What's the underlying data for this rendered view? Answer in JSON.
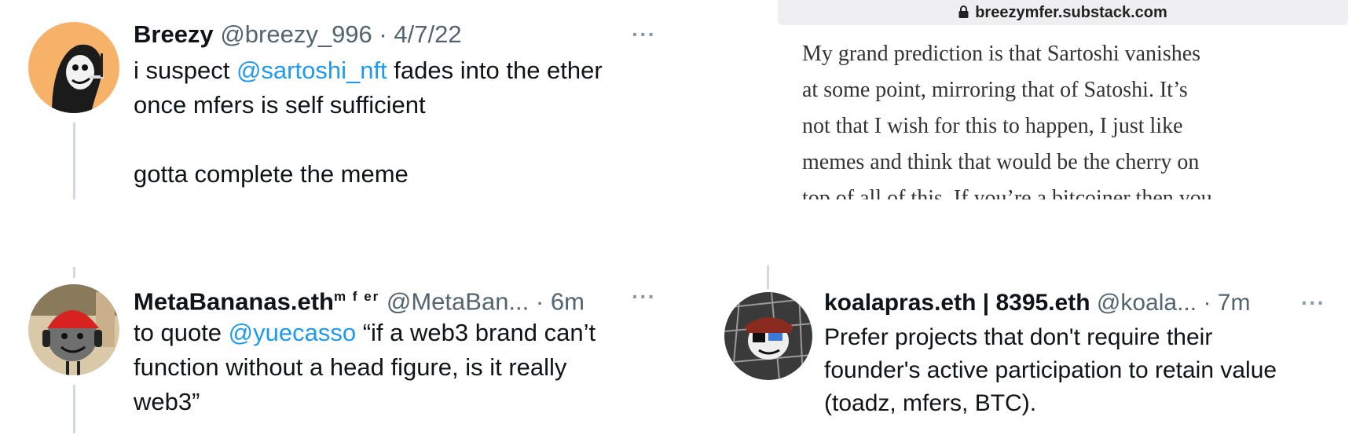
{
  "tweet1": {
    "display_name": "Breezy",
    "handle": "@breezy_996",
    "separator": "·",
    "timestamp": "4/7/22",
    "more": "···",
    "text_before": "i suspect ",
    "mention": "@sartoshi_nft",
    "text_after": " fades into the ether",
    "line2": "once mfers is self sufficient",
    "line3": "gotta complete the meme"
  },
  "substack": {
    "url": "breezymfer.substack.com",
    "lock_icon": "lock-icon",
    "lines": [
      "My grand prediction is that Sartoshi vanishes",
      "at some point, mirroring that of Satoshi. It’s",
      "not that I wish for this to happen, I just like",
      "memes and think that would be the cherry on",
      "top of all of this. If you’re a bitcoiner then you"
    ]
  },
  "tweet2": {
    "display_name": "MetaBananas.eth",
    "name_suffix": "m f er",
    "handle": "@MetaBan...",
    "separator": "·",
    "timestamp": "6m",
    "more": "···",
    "text_before": "to quote ",
    "mention": "@yuecasso",
    "text_after": " “if a web3 brand can’t",
    "line2": "function without a head figure, is it really",
    "line3": "web3”"
  },
  "tweet3": {
    "display_name": "koalapras.eth | 8395.eth",
    "handle": "@koala...",
    "separator": "·",
    "timestamp": "7m",
    "more": "···",
    "line1": "Prefer projects that don't require their",
    "line2": "founder's active participation to retain value",
    "line3": "(toadz, mfers, BTC)."
  },
  "colors": {
    "link": "#1d9bf0",
    "meta_gray": "#536471",
    "thread_line": "#cfd9de",
    "avatar1_bg": "#f7b26a"
  }
}
